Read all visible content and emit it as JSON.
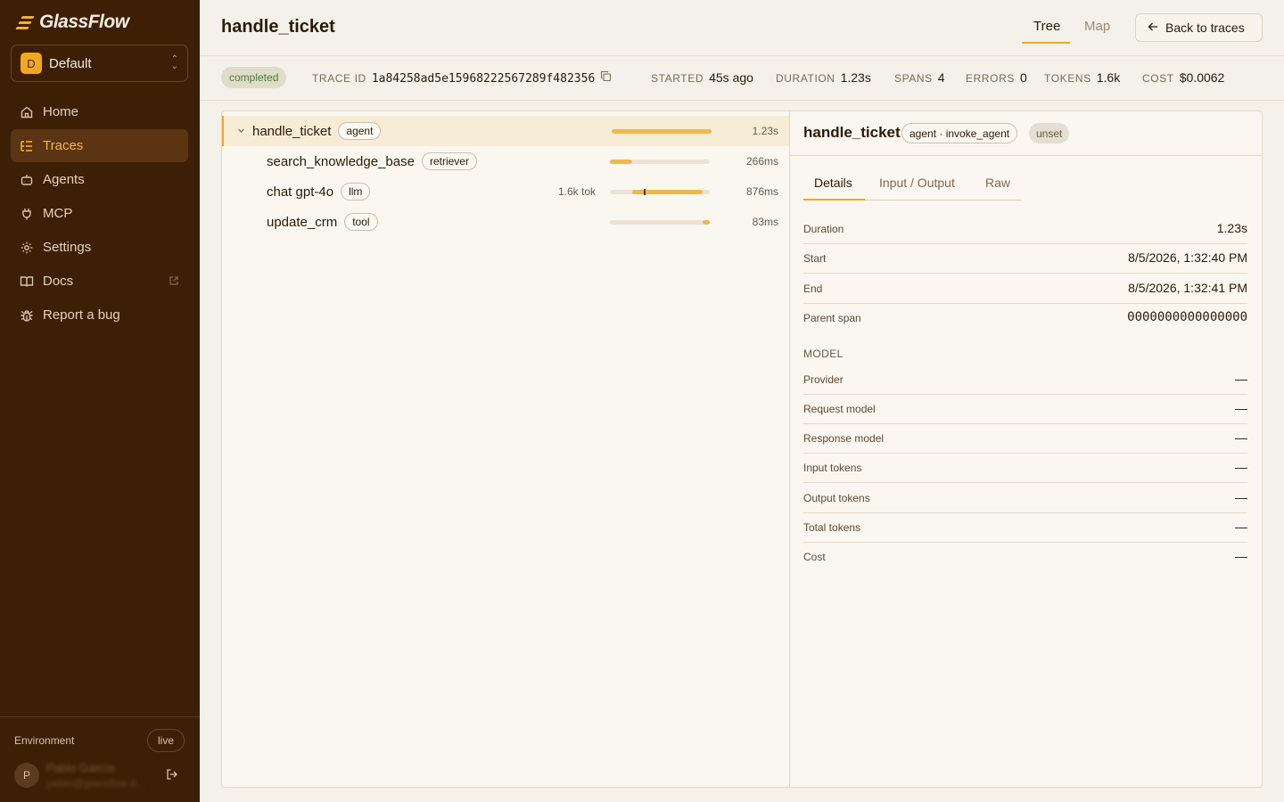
{
  "brand": {
    "name": "GlassFlow"
  },
  "workspace": {
    "initial": "D",
    "name": "Default"
  },
  "nav": {
    "home": "Home",
    "traces": "Traces",
    "agents": "Agents",
    "mcp": "MCP",
    "settings": "Settings",
    "docs": "Docs",
    "report_bug": "Report a bug"
  },
  "environment": {
    "label": "Environment",
    "value": "live"
  },
  "user": {
    "initial": "P",
    "name": "Pablo García",
    "email": "pablo@glassflow.d..."
  },
  "header": {
    "title": "handle_ticket",
    "tab_tree": "Tree",
    "tab_map": "Map",
    "back_label": "Back to traces"
  },
  "meta": {
    "status": "completed",
    "trace_id_label": "TRACE ID",
    "trace_id": "1a84258ad5e15968222567289f482356",
    "started_label": "STARTED",
    "started": "45s ago",
    "duration_label": "DURATION",
    "duration": "1.23s",
    "spans_label": "SPANS",
    "spans": "4",
    "errors_label": "ERRORS",
    "errors": "0",
    "tokens_label": "TOKENS",
    "tokens": "1.6k",
    "cost_label": "COST",
    "cost": "$0.0062"
  },
  "spans": [
    {
      "name": "handle_ticket",
      "kind": "agent",
      "tokens": "",
      "duration": "1.23s",
      "start_frac": 0.0,
      "width_frac": 1.0
    },
    {
      "name": "search_knowledge_base",
      "kind": "retriever",
      "tokens": "",
      "duration": "266ms",
      "start_frac": 0.0,
      "width_frac": 0.22
    },
    {
      "name": "chat gpt-4o",
      "kind": "llm",
      "tokens": "1.6k tok",
      "duration": "876ms",
      "start_frac": 0.22,
      "width_frac": 0.71,
      "marker_frac": 0.34
    },
    {
      "name": "update_crm",
      "kind": "tool",
      "tokens": "",
      "duration": "83ms",
      "start_frac": 0.93,
      "width_frac": 0.07
    }
  ],
  "detail": {
    "title": "handle_ticket",
    "kind_pill": "agent · invoke_agent",
    "status_pill": "unset",
    "tabs": [
      "Details",
      "Input / Output",
      "Raw"
    ],
    "fields": [
      {
        "key": "Duration",
        "value": "1.23s"
      },
      {
        "key": "Start",
        "value": "8/5/2026, 1:32:40 PM"
      },
      {
        "key": "End",
        "value": "8/5/2026, 1:32:41 PM"
      },
      {
        "key": "Parent span",
        "value": "0000000000000000"
      }
    ],
    "model_heading": "MODEL",
    "model_fields": [
      {
        "key": "Provider",
        "value": "—"
      },
      {
        "key": "Request model",
        "value": "—"
      },
      {
        "key": "Response model",
        "value": "—"
      },
      {
        "key": "Input tokens",
        "value": "—"
      },
      {
        "key": "Output tokens",
        "value": "—"
      },
      {
        "key": "Total tokens",
        "value": "—"
      },
      {
        "key": "Cost",
        "value": "—"
      }
    ]
  },
  "colors": {
    "sidebar": "#3d1f05",
    "accent": "#f0a820",
    "background": "#f3f1e9",
    "status_ok": "#4f7a3a"
  }
}
